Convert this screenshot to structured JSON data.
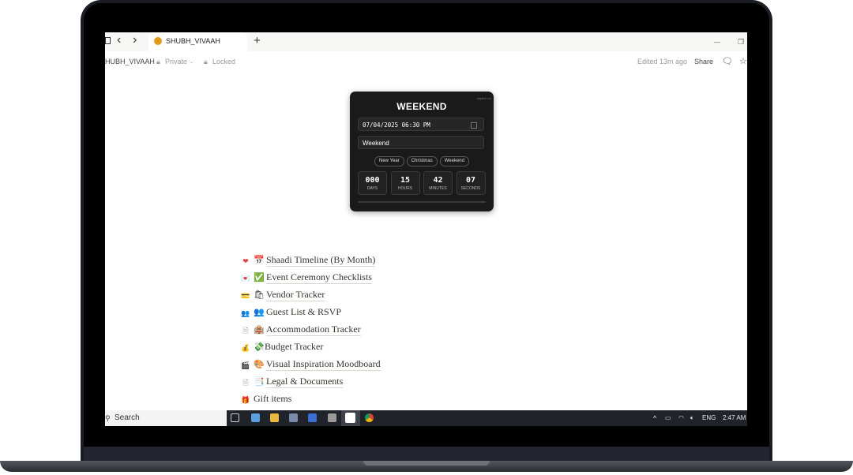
{
  "browser": {
    "tab_title": "SHUBH_VIVAAH",
    "new_tab_glyph": "+",
    "minimize_glyph": "—",
    "restore_glyph": "❐",
    "back_glyph": "‹",
    "forward_glyph": "›"
  },
  "breadcrumb": {
    "page_name": "HUBH_VIVAAH",
    "privacy": "Private",
    "lock_state": "Locked",
    "edited": "Edited 13m ago",
    "share": "Share"
  },
  "widget": {
    "title": "WEEKEND",
    "corner_text": "apption.co",
    "datetime_value": "07/04/2025 06:30 PM",
    "event_name_value": "Weekend",
    "presets": [
      "New Year",
      "Christmas",
      "Weekend"
    ],
    "countdown": [
      {
        "value": "000",
        "label": "DAYS"
      },
      {
        "value": "15",
        "label": "HOURS"
      },
      {
        "value": "42",
        "label": "MINUTES"
      },
      {
        "value": "07",
        "label": "SECONDS"
      }
    ]
  },
  "pages": [
    {
      "icon": "❤",
      "icon_color": "#e03e3e",
      "emoji": "📅",
      "label": "Shaadi Timeline (By Month)"
    },
    {
      "icon": "💌",
      "icon_color": "#d9467a",
      "emoji": "✅",
      "label": "Event Ceremony Checklists"
    },
    {
      "icon": "💳",
      "icon_color": "#d9a000",
      "emoji": "🛍",
      "label": "Vendor Tracker"
    },
    {
      "icon": "👥",
      "icon_color": "#2f6fb5",
      "emoji": "👥",
      "label": "Guest List & RSVP"
    },
    {
      "icon": "🗎",
      "icon_color": "#888888",
      "emoji": "🏨",
      "label": "Accommodation Tracker"
    },
    {
      "icon": "💰",
      "icon_color": "#c9962a",
      "emoji": "💸",
      "label": "Budget Tracker"
    },
    {
      "icon": "🎬",
      "icon_color": "#333333",
      "emoji": "🎨",
      "label": "Visual Inspiration Moodboard"
    },
    {
      "icon": "🗎",
      "icon_color": "#888888",
      "emoji": "📑",
      "label": "Legal & Documents"
    },
    {
      "icon": "🎁",
      "icon_color": "#e06a2a",
      "emoji": "",
      "label": "Gift items"
    }
  ],
  "taskbar": {
    "search_placeholder": "Search",
    "language": "ENG",
    "time": "2:47 AM"
  },
  "colors": {
    "widget_bg": "#1a1a1a",
    "taskbar_bg": "#20232a",
    "laptop_frame": "#1b1d24"
  }
}
